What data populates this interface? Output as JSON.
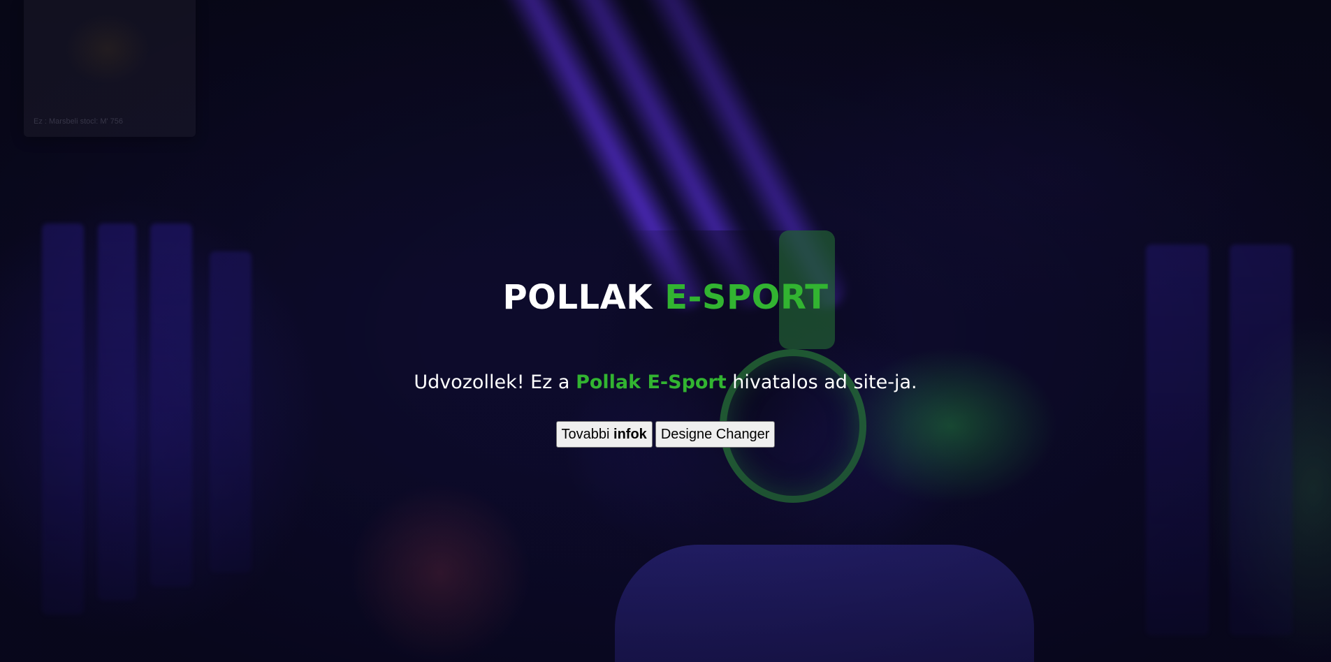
{
  "ghost_card": {
    "caption": "Ez : Marsbeli stocl: M' 756"
  },
  "hero": {
    "title_white": "POLLAK",
    "title_green": "E-SPORT",
    "subtitle_prefix": "Udvozollek! Ez a",
    "subtitle_highlight": "Pollak E-Sport",
    "subtitle_suffix": "hivatalos ad site-ja."
  },
  "buttons": {
    "more_info_prefix": "Tovabbi",
    "more_info_bold": "infok",
    "design_changer": "Designe Changer"
  },
  "colors": {
    "accent_green": "#32b431",
    "text_white": "#ffffff",
    "background_dark": "#0c0a2a"
  }
}
